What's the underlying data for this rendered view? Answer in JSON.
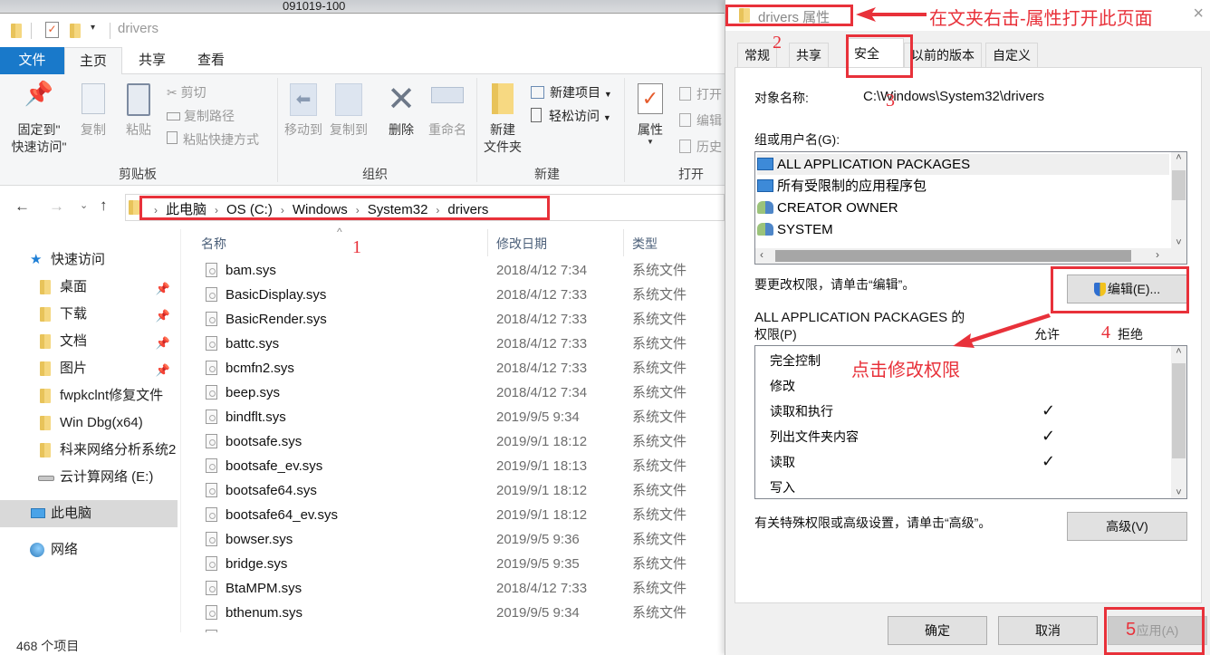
{
  "desktop": {
    "label": "091019-100"
  },
  "explorer": {
    "title": "drivers",
    "ribbon_tabs": [
      {
        "label": "文件",
        "active": false,
        "file_tab": true
      },
      {
        "label": "主页",
        "active": true
      },
      {
        "label": "共享",
        "active": false
      },
      {
        "label": "查看",
        "active": false
      }
    ],
    "ribbon": {
      "clipboard": {
        "pin_label_1": "固定到\"",
        "pin_label_2": "快速访问\"",
        "copy": "复制",
        "paste": "粘贴",
        "cut": "剪切",
        "copy_path": "复制路径",
        "paste_shortcut": "粘贴快捷方式",
        "group": "剪贴板"
      },
      "organize": {
        "move_to": "移动到",
        "copy_to": "复制到",
        "delete": "删除",
        "rename": "重命名",
        "group": "组织"
      },
      "new": {
        "new_folder_1": "新建",
        "new_folder_2": "文件夹",
        "new_item": "新建项目",
        "easy_access": "轻松访问",
        "group": "新建"
      },
      "open": {
        "properties": "属性",
        "open": "打开",
        "edit": "编辑",
        "history": "历史",
        "group": "打开"
      }
    },
    "breadcrumb": [
      "此电脑",
      "OS (C:)",
      "Windows",
      "System32",
      "drivers"
    ],
    "nav": [
      {
        "label": "快速访问",
        "icon": "star-icon",
        "pinned": false,
        "indent": 1
      },
      {
        "label": "桌面",
        "icon": "desktop-folder-icon",
        "pinned": true,
        "indent": 2
      },
      {
        "label": "下载",
        "icon": "download-folder-icon",
        "pinned": true,
        "indent": 2
      },
      {
        "label": "文档",
        "icon": "documents-folder-icon",
        "pinned": true,
        "indent": 2
      },
      {
        "label": "图片",
        "icon": "pictures-folder-icon",
        "pinned": true,
        "indent": 2
      },
      {
        "label": "fwpkclnt修复文件",
        "icon": "folder-icon",
        "pinned": false,
        "indent": 2
      },
      {
        "label": "Win Dbg(x64)",
        "icon": "folder-icon",
        "pinned": false,
        "indent": 2
      },
      {
        "label": "科来网络分析系统2",
        "icon": "folder-icon",
        "pinned": false,
        "indent": 2
      },
      {
        "label": "云计算网络 (E:)",
        "icon": "drive-icon",
        "pinned": false,
        "indent": 2
      },
      {
        "label": "此电脑",
        "icon": "computer-icon",
        "pinned": false,
        "indent": 1,
        "selected": true
      },
      {
        "label": "网络",
        "icon": "network-icon",
        "pinned": false,
        "indent": 1
      }
    ],
    "columns": {
      "name": "名称",
      "date": "修改日期",
      "type": "类型"
    },
    "files": [
      {
        "name": "bam.sys",
        "date": "2018/4/12 7:34",
        "type": "系统文件"
      },
      {
        "name": "BasicDisplay.sys",
        "date": "2018/4/12 7:33",
        "type": "系统文件"
      },
      {
        "name": "BasicRender.sys",
        "date": "2018/4/12 7:33",
        "type": "系统文件"
      },
      {
        "name": "battc.sys",
        "date": "2018/4/12 7:33",
        "type": "系统文件"
      },
      {
        "name": "bcmfn2.sys",
        "date": "2018/4/12 7:33",
        "type": "系统文件"
      },
      {
        "name": "beep.sys",
        "date": "2018/4/12 7:34",
        "type": "系统文件"
      },
      {
        "name": "bindflt.sys",
        "date": "2019/9/5 9:34",
        "type": "系统文件"
      },
      {
        "name": "bootsafe.sys",
        "date": "2019/9/1 18:12",
        "type": "系统文件"
      },
      {
        "name": "bootsafe_ev.sys",
        "date": "2019/9/1 18:13",
        "type": "系统文件"
      },
      {
        "name": "bootsafe64.sys",
        "date": "2019/9/1 18:12",
        "type": "系统文件"
      },
      {
        "name": "bootsafe64_ev.sys",
        "date": "2019/9/1 18:12",
        "type": "系统文件"
      },
      {
        "name": "bowser.sys",
        "date": "2019/9/5 9:36",
        "type": "系统文件"
      },
      {
        "name": "bridge.sys",
        "date": "2019/9/5 9:35",
        "type": "系统文件"
      },
      {
        "name": "BtaMPM.sys",
        "date": "2018/4/12 7:33",
        "type": "系统文件"
      },
      {
        "name": "bthenum.sys",
        "date": "2019/9/5 9:34",
        "type": "系统文件"
      }
    ],
    "status": "468 个项目"
  },
  "dialog": {
    "title": "drivers 属性",
    "tabs": [
      {
        "label": "常规",
        "active": false
      },
      {
        "label": "共享",
        "active": false
      },
      {
        "label": "安全",
        "active": true
      },
      {
        "label": "以前的版本",
        "active": false
      },
      {
        "label": "自定义",
        "active": false
      }
    ],
    "object_name_label": "对象名称:",
    "object_name_value": "C:\\Windows\\System32\\drivers",
    "groups_label": "组或用户名(G):",
    "groups": [
      {
        "name": "ALL APPLICATION PACKAGES",
        "icon": "app-package-icon",
        "selected": true
      },
      {
        "name": "所有受限制的应用程序包",
        "icon": "app-package-icon",
        "selected": false
      },
      {
        "name": "CREATOR OWNER",
        "icon": "users-icon",
        "selected": false
      },
      {
        "name": "SYSTEM",
        "icon": "users-icon",
        "selected": false
      }
    ],
    "edit_hint": "要更改权限，请单击“编辑”。",
    "edit_button": "编辑(E)...",
    "perm_title_1": "ALL APPLICATION PACKAGES 的",
    "perm_title_2": "权限(P)",
    "allow_label": "允许",
    "deny_label": "拒绝",
    "permissions": [
      {
        "name": "完全控制",
        "allow": false,
        "deny": false
      },
      {
        "name": "修改",
        "allow": false,
        "deny": false
      },
      {
        "name": "读取和执行",
        "allow": true,
        "deny": false
      },
      {
        "name": "列出文件夹内容",
        "allow": true,
        "deny": false
      },
      {
        "name": "读取",
        "allow": true,
        "deny": false
      },
      {
        "name": "写入",
        "allow": false,
        "deny": false
      }
    ],
    "advanced_hint": "有关特殊权限或高级设置，请单击“高级”。",
    "advanced_button": "高级(V)",
    "ok_button": "确定",
    "cancel_button": "取消",
    "apply_button": "应用(A)"
  },
  "annotations": {
    "title_note": "在文夹右击-属性打开此页面",
    "edit_note": "点击修改权限",
    "steps": [
      "1",
      "2",
      "3",
      "4",
      "5"
    ],
    "color": "#e8313a"
  }
}
